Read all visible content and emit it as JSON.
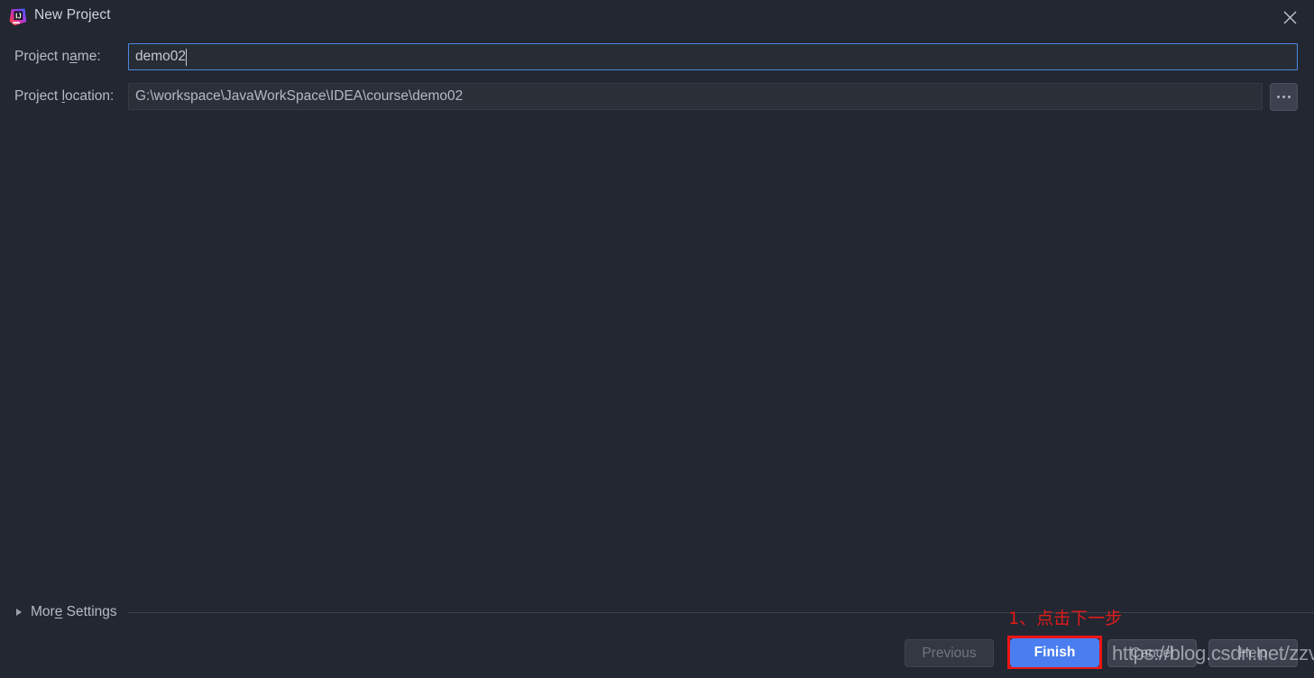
{
  "window": {
    "title": "New Project",
    "app_icon": "intellij-idea-logo",
    "close_icon": "close-icon",
    "background_color": "#232731"
  },
  "form": {
    "project_name": {
      "label": "Project name:",
      "label_prefix": "Project n",
      "label_mnemonic": "a",
      "label_suffix": "me:",
      "value": "demo02",
      "focused": true,
      "focus_border_color": "#4a88e0"
    },
    "project_location": {
      "label": "Project location:",
      "label_prefix": "Project ",
      "label_mnemonic": "l",
      "label_suffix": "ocation:",
      "value": "G:\\workspace\\JavaWorkSpace\\IDEA\\course\\demo02"
    },
    "browse_button": {
      "label": "...",
      "icon": "ellipsis-icon"
    }
  },
  "more_settings": {
    "label_prefix": "Mor",
    "label_mnemonic": "e",
    "label_suffix": " Settings",
    "label": "More Settings",
    "expanded": false,
    "arrow_icon": "triangle-right-icon"
  },
  "annotation": {
    "text": "1、点击下一步",
    "color": "#ef1414",
    "highlight_target": "finish-button"
  },
  "buttons": {
    "previous": {
      "label": "Previous",
      "mnemonic": "P",
      "enabled": false
    },
    "finish": {
      "label": "Finish",
      "mnemonic": "F",
      "enabled": true,
      "default": true,
      "color": "#4a7ef0"
    },
    "cancel": {
      "label": "Cancel",
      "mnemonic": "C",
      "enabled": true
    },
    "help": {
      "label": "Help",
      "mnemonic": "H",
      "enabled": true
    }
  },
  "watermark": {
    "text": "https://blog.csdn.net/zzvar"
  }
}
